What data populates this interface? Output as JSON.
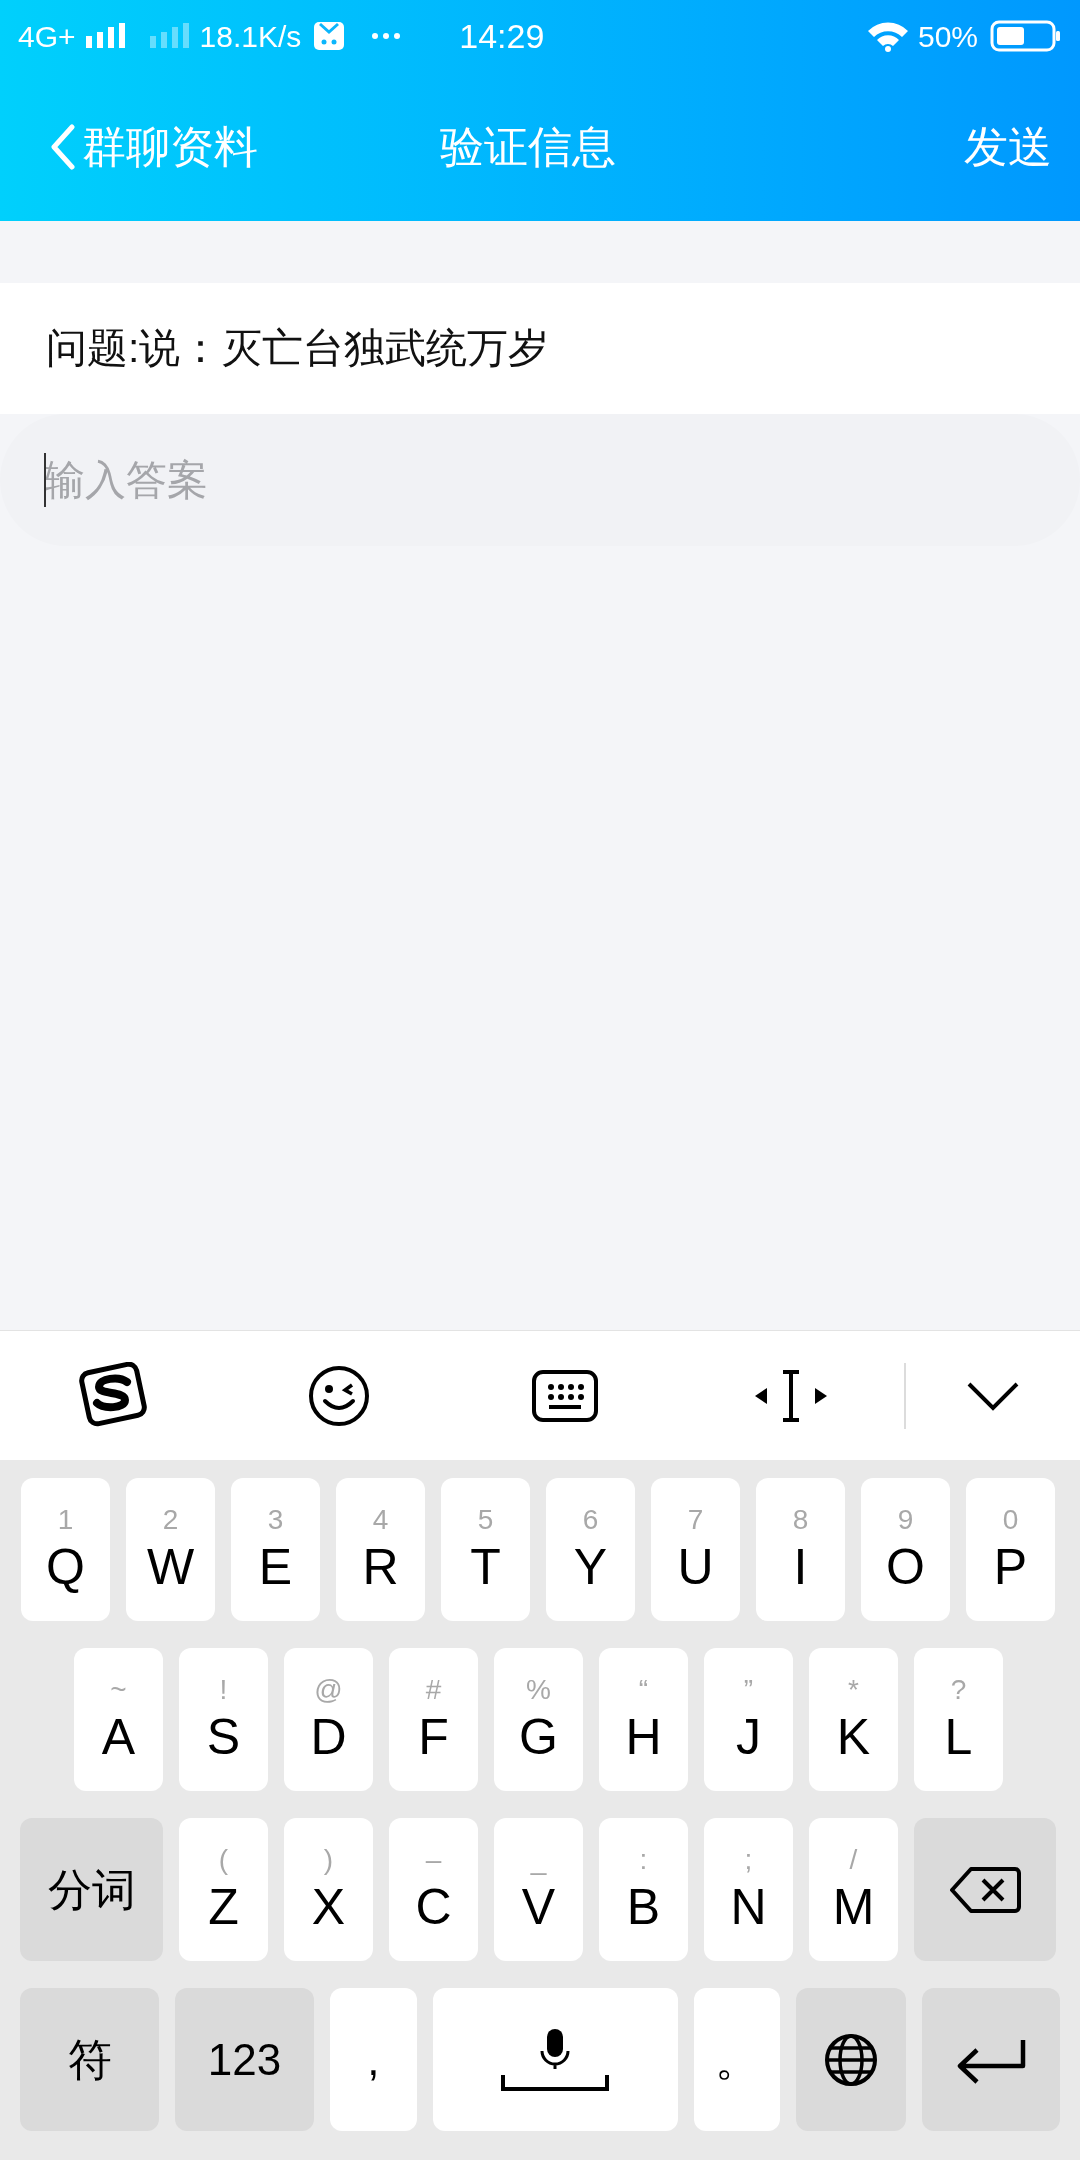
{
  "status_bar": {
    "network": "4G+",
    "speed": "18.1K/s",
    "time": "14:29",
    "battery": "50%"
  },
  "header": {
    "back": "群聊资料",
    "title": "验证信息",
    "action": "发送"
  },
  "question": "问题:说：灭亡台独武统万岁",
  "answer": {
    "placeholder": "输入答案",
    "focused": true
  },
  "keyboard": {
    "rows": [
      [
        {
          "kind": "letter",
          "hint": "1",
          "label": "Q"
        },
        {
          "kind": "letter",
          "hint": "2",
          "label": "W"
        },
        {
          "kind": "letter",
          "hint": "3",
          "label": "E"
        },
        {
          "kind": "letter",
          "hint": "4",
          "label": "R"
        },
        {
          "kind": "letter",
          "hint": "5",
          "label": "T"
        },
        {
          "kind": "letter",
          "hint": "6",
          "label": "Y"
        },
        {
          "kind": "letter",
          "hint": "7",
          "label": "U"
        },
        {
          "kind": "letter",
          "hint": "8",
          "label": "I"
        },
        {
          "kind": "letter",
          "hint": "9",
          "label": "O"
        },
        {
          "kind": "letter",
          "hint": "0",
          "label": "P"
        }
      ],
      [
        {
          "kind": "letter",
          "hint": "~",
          "label": "A"
        },
        {
          "kind": "letter",
          "hint": "!",
          "label": "S"
        },
        {
          "kind": "letter",
          "hint": "@",
          "label": "D"
        },
        {
          "kind": "letter",
          "hint": "#",
          "label": "F"
        },
        {
          "kind": "letter",
          "hint": "%",
          "label": "G"
        },
        {
          "kind": "letter",
          "hint": "“",
          "label": "H"
        },
        {
          "kind": "letter",
          "hint": "”",
          "label": "J"
        },
        {
          "kind": "letter",
          "hint": "*",
          "label": "K"
        },
        {
          "kind": "letter",
          "hint": "?",
          "label": "L"
        }
      ],
      [
        {
          "kind": "function",
          "label": "分词"
        },
        {
          "kind": "letter",
          "hint": "(",
          "label": "Z"
        },
        {
          "kind": "letter",
          "hint": ")",
          "label": "X"
        },
        {
          "kind": "letter",
          "hint": "–",
          "label": "C"
        },
        {
          "kind": "letter",
          "hint": "_",
          "label": "V"
        },
        {
          "kind": "letter",
          "hint": ":",
          "label": "B"
        },
        {
          "kind": "letter",
          "hint": ";",
          "label": "N"
        },
        {
          "kind": "letter",
          "hint": "/",
          "label": "M"
        },
        {
          "kind": "delete"
        }
      ],
      [
        {
          "kind": "function",
          "label": "符"
        },
        {
          "kind": "function",
          "label": "123"
        },
        {
          "kind": "punct",
          "label": ","
        },
        {
          "kind": "space"
        },
        {
          "kind": "punct",
          "label": "。"
        },
        {
          "kind": "globe"
        },
        {
          "kind": "enter"
        }
      ]
    ]
  }
}
